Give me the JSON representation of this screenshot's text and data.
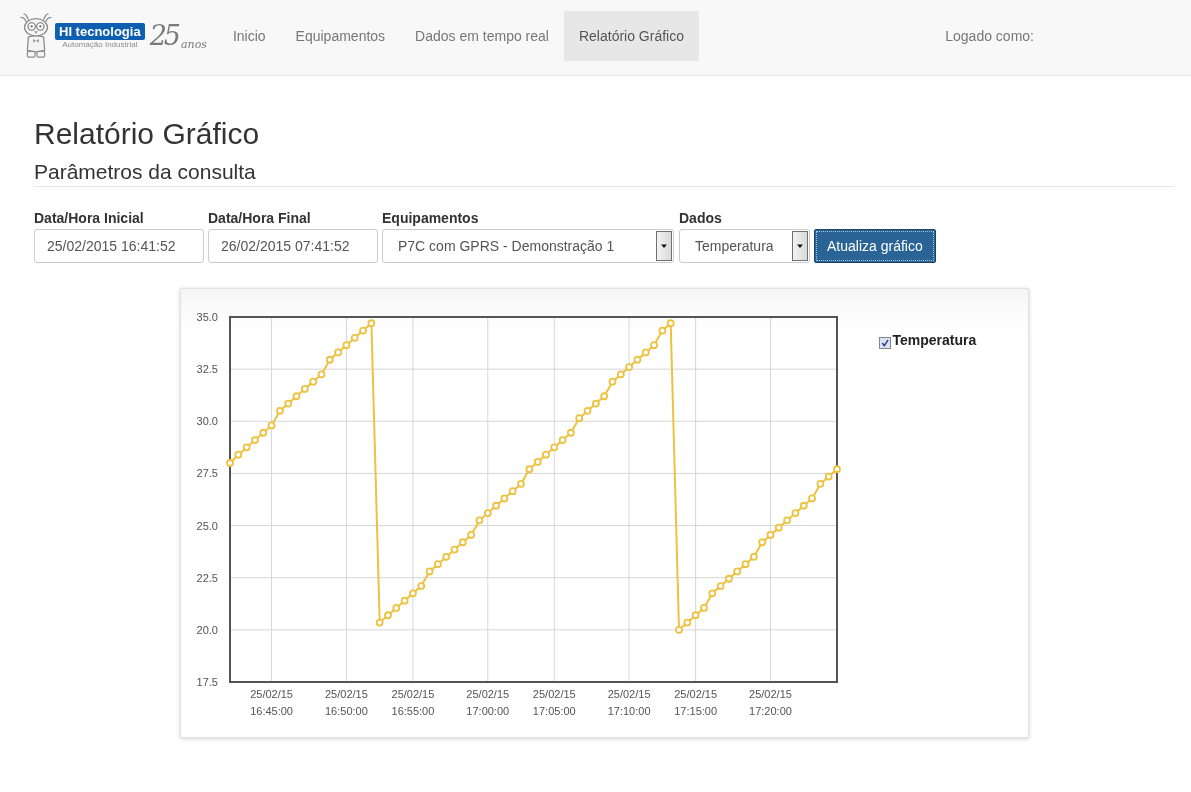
{
  "navbar": {
    "logo": {
      "brand": "HI tecnologia",
      "tagline": "Automação Industrial",
      "anniversary_number": "25",
      "anniversary_word": "anos"
    },
    "items": [
      {
        "label": "Inicio",
        "selected": false
      },
      {
        "label": "Equipamentos",
        "selected": false
      },
      {
        "label": "Dados em tempo real",
        "selected": false
      },
      {
        "label": "Relatório Gráfico",
        "selected": true
      }
    ],
    "user_label": "Logado como:"
  },
  "page": {
    "title": "Relatório Gráfico",
    "section_title": "Parâmetros da consulta"
  },
  "form": {
    "fields": [
      {
        "kind": "input",
        "label": "Data/Hora Inicial",
        "value": "25/02/2015 16:41:52"
      },
      {
        "kind": "input",
        "label": "Data/Hora Final",
        "value": "26/02/2015 07:41:52"
      },
      {
        "kind": "select",
        "label": "Equipamentos",
        "value": "P7C com GPRS - Demonstração 1"
      },
      {
        "kind": "select",
        "label": "Dados",
        "value": "Temperatura"
      }
    ],
    "button": "Atualiza gráfico"
  },
  "chart": {
    "legend": [
      {
        "label": "Temperatura",
        "checked": true
      }
    ],
    "chart_data": {
      "type": "line",
      "grid": true,
      "categories": [
        null,
        null,
        null,
        null,
        null,
        "25/02/15 16:45:00",
        null,
        null,
        null,
        null,
        null,
        null,
        null,
        null,
        "25/02/15 16:50:00",
        null,
        null,
        null,
        null,
        null,
        null,
        null,
        "25/02/15 16:55:00",
        null,
        null,
        null,
        null,
        null,
        null,
        null,
        null,
        "25/02/15 17:00:00",
        null,
        null,
        null,
        null,
        null,
        null,
        null,
        "25/02/15 17:05:00",
        null,
        null,
        null,
        null,
        null,
        null,
        null,
        null,
        "25/02/15 17:10:00",
        null,
        null,
        null,
        null,
        null,
        null,
        null,
        "25/02/15 17:15:00",
        null,
        null,
        null,
        null,
        null,
        null,
        null,
        null,
        "25/02/15 17:20:00",
        null,
        null,
        null,
        null,
        null,
        null,
        null,
        null
      ],
      "series": [
        {
          "color": "#edc240",
          "marker": "circle",
          "values": [
            28.0,
            28.4,
            28.75,
            29.1,
            29.45,
            29.8,
            30.5,
            30.85,
            31.2,
            31.55,
            31.9,
            32.25,
            32.95,
            33.3,
            33.65,
            34.0,
            34.35,
            34.7,
            20.35,
            20.7,
            21.05,
            21.4,
            21.75,
            22.1,
            22.8,
            23.15,
            23.5,
            23.85,
            24.2,
            24.55,
            25.25,
            25.6,
            25.95,
            26.3,
            26.65,
            27.0,
            27.7,
            28.05,
            28.4,
            28.75,
            29.1,
            29.45,
            30.15,
            30.5,
            30.85,
            31.2,
            31.9,
            32.25,
            32.6,
            32.95,
            33.3,
            33.65,
            34.35,
            34.7,
            20.0,
            20.35,
            20.7,
            21.05,
            21.75,
            22.1,
            22.45,
            22.8,
            23.15,
            23.5,
            24.2,
            24.55,
            24.9,
            25.25,
            25.6,
            25.95,
            26.3,
            27.0,
            27.35,
            27.7
          ]
        }
      ],
      "ylim": [
        17.5,
        35
      ],
      "yticks": [
        {
          "value": 17.5,
          "label": "17.5"
        },
        {
          "value": 20,
          "label": "20.0"
        },
        {
          "value": 22.5,
          "label": "22.5"
        },
        {
          "value": 25,
          "label": "25.0"
        },
        {
          "value": 27.5,
          "label": "27.5"
        },
        {
          "value": 30,
          "label": "30.0"
        },
        {
          "value": 32.5,
          "label": "32.5"
        },
        {
          "value": 35,
          "label": "35.0"
        }
      ]
    }
  }
}
